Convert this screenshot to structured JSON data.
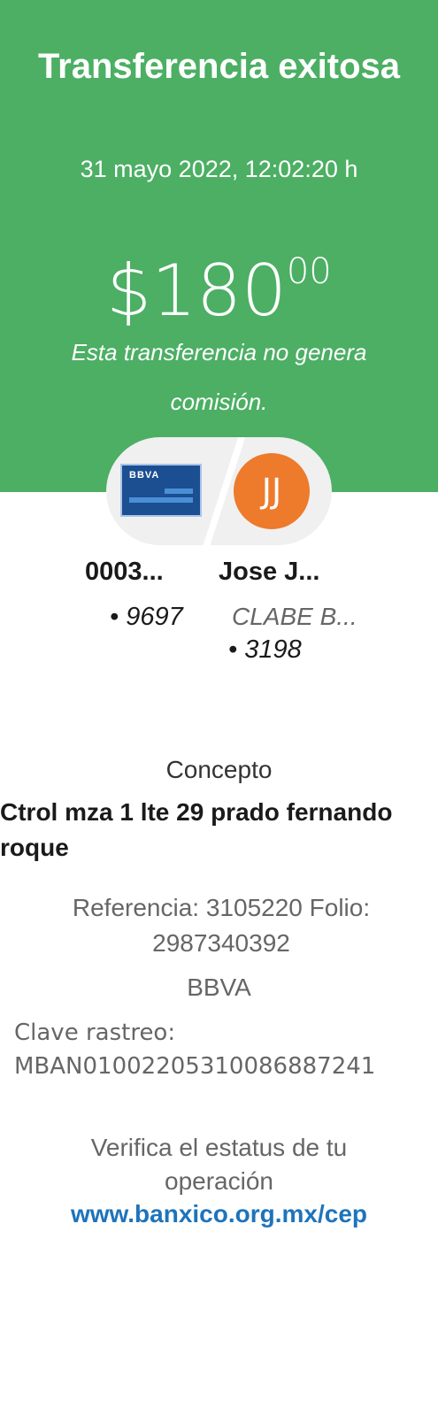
{
  "header": {
    "title": "Transferencia exitosa",
    "datetime": "31 mayo 2022, 12:02:20 h",
    "amount_main": "$180",
    "amount_cents": "00",
    "note": "Esta transferencia no genera comisión."
  },
  "origin": {
    "card_brand": "BBVA",
    "name": "0003...",
    "number": "• 9697"
  },
  "destination": {
    "initials": "JJ",
    "name": "Jose J...",
    "type": "CLABE B...",
    "number": "• 3198"
  },
  "details": {
    "concept_label": "Concepto",
    "concept_text": "Ctrol mza 1 lte 29 prado fernando roque",
    "reference_line": "Referencia: 3105220   Folio: 2987340392",
    "bank": "BBVA",
    "clave_label": "Clave rastreo:",
    "clave_value": "MBAN01002205310086887241",
    "verify_text": "Verifica el estatus de tu operación",
    "verify_link": "www.banxico.org.mx/cep"
  },
  "colors": {
    "header_green": "#4caf64",
    "avatar_orange": "#ee7a2c",
    "link_blue": "#1e74bb",
    "card_blue": "#1b4f91"
  },
  "icons": [
    "bbva-card-icon",
    "avatar-initials"
  ]
}
